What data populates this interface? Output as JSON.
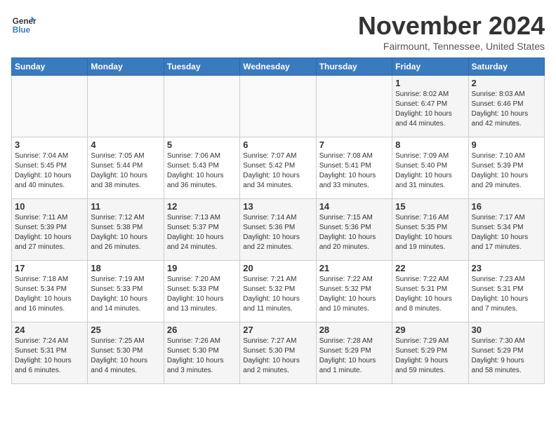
{
  "header": {
    "logo_line1": "General",
    "logo_line2": "Blue",
    "month": "November 2024",
    "location": "Fairmount, Tennessee, United States"
  },
  "weekdays": [
    "Sunday",
    "Monday",
    "Tuesday",
    "Wednesday",
    "Thursday",
    "Friday",
    "Saturday"
  ],
  "weeks": [
    [
      {
        "day": "",
        "info": ""
      },
      {
        "day": "",
        "info": ""
      },
      {
        "day": "",
        "info": ""
      },
      {
        "day": "",
        "info": ""
      },
      {
        "day": "",
        "info": ""
      },
      {
        "day": "1",
        "info": "Sunrise: 8:02 AM\nSunset: 6:47 PM\nDaylight: 10 hours\nand 44 minutes."
      },
      {
        "day": "2",
        "info": "Sunrise: 8:03 AM\nSunset: 6:46 PM\nDaylight: 10 hours\nand 42 minutes."
      }
    ],
    [
      {
        "day": "3",
        "info": "Sunrise: 7:04 AM\nSunset: 5:45 PM\nDaylight: 10 hours\nand 40 minutes."
      },
      {
        "day": "4",
        "info": "Sunrise: 7:05 AM\nSunset: 5:44 PM\nDaylight: 10 hours\nand 38 minutes."
      },
      {
        "day": "5",
        "info": "Sunrise: 7:06 AM\nSunset: 5:43 PM\nDaylight: 10 hours\nand 36 minutes."
      },
      {
        "day": "6",
        "info": "Sunrise: 7:07 AM\nSunset: 5:42 PM\nDaylight: 10 hours\nand 34 minutes."
      },
      {
        "day": "7",
        "info": "Sunrise: 7:08 AM\nSunset: 5:41 PM\nDaylight: 10 hours\nand 33 minutes."
      },
      {
        "day": "8",
        "info": "Sunrise: 7:09 AM\nSunset: 5:40 PM\nDaylight: 10 hours\nand 31 minutes."
      },
      {
        "day": "9",
        "info": "Sunrise: 7:10 AM\nSunset: 5:39 PM\nDaylight: 10 hours\nand 29 minutes."
      }
    ],
    [
      {
        "day": "10",
        "info": "Sunrise: 7:11 AM\nSunset: 5:39 PM\nDaylight: 10 hours\nand 27 minutes."
      },
      {
        "day": "11",
        "info": "Sunrise: 7:12 AM\nSunset: 5:38 PM\nDaylight: 10 hours\nand 26 minutes."
      },
      {
        "day": "12",
        "info": "Sunrise: 7:13 AM\nSunset: 5:37 PM\nDaylight: 10 hours\nand 24 minutes."
      },
      {
        "day": "13",
        "info": "Sunrise: 7:14 AM\nSunset: 5:36 PM\nDaylight: 10 hours\nand 22 minutes."
      },
      {
        "day": "14",
        "info": "Sunrise: 7:15 AM\nSunset: 5:36 PM\nDaylight: 10 hours\nand 20 minutes."
      },
      {
        "day": "15",
        "info": "Sunrise: 7:16 AM\nSunset: 5:35 PM\nDaylight: 10 hours\nand 19 minutes."
      },
      {
        "day": "16",
        "info": "Sunrise: 7:17 AM\nSunset: 5:34 PM\nDaylight: 10 hours\nand 17 minutes."
      }
    ],
    [
      {
        "day": "17",
        "info": "Sunrise: 7:18 AM\nSunset: 5:34 PM\nDaylight: 10 hours\nand 16 minutes."
      },
      {
        "day": "18",
        "info": "Sunrise: 7:19 AM\nSunset: 5:33 PM\nDaylight: 10 hours\nand 14 minutes."
      },
      {
        "day": "19",
        "info": "Sunrise: 7:20 AM\nSunset: 5:33 PM\nDaylight: 10 hours\nand 13 minutes."
      },
      {
        "day": "20",
        "info": "Sunrise: 7:21 AM\nSunset: 5:32 PM\nDaylight: 10 hours\nand 11 minutes."
      },
      {
        "day": "21",
        "info": "Sunrise: 7:22 AM\nSunset: 5:32 PM\nDaylight: 10 hours\nand 10 minutes."
      },
      {
        "day": "22",
        "info": "Sunrise: 7:22 AM\nSunset: 5:31 PM\nDaylight: 10 hours\nand 8 minutes."
      },
      {
        "day": "23",
        "info": "Sunrise: 7:23 AM\nSunset: 5:31 PM\nDaylight: 10 hours\nand 7 minutes."
      }
    ],
    [
      {
        "day": "24",
        "info": "Sunrise: 7:24 AM\nSunset: 5:31 PM\nDaylight: 10 hours\nand 6 minutes."
      },
      {
        "day": "25",
        "info": "Sunrise: 7:25 AM\nSunset: 5:30 PM\nDaylight: 10 hours\nand 4 minutes."
      },
      {
        "day": "26",
        "info": "Sunrise: 7:26 AM\nSunset: 5:30 PM\nDaylight: 10 hours\nand 3 minutes."
      },
      {
        "day": "27",
        "info": "Sunrise: 7:27 AM\nSunset: 5:30 PM\nDaylight: 10 hours\nand 2 minutes."
      },
      {
        "day": "28",
        "info": "Sunrise: 7:28 AM\nSunset: 5:29 PM\nDaylight: 10 hours\nand 1 minute."
      },
      {
        "day": "29",
        "info": "Sunrise: 7:29 AM\nSunset: 5:29 PM\nDaylight: 9 hours\nand 59 minutes."
      },
      {
        "day": "30",
        "info": "Sunrise: 7:30 AM\nSunset: 5:29 PM\nDaylight: 9 hours\nand 58 minutes."
      }
    ]
  ]
}
